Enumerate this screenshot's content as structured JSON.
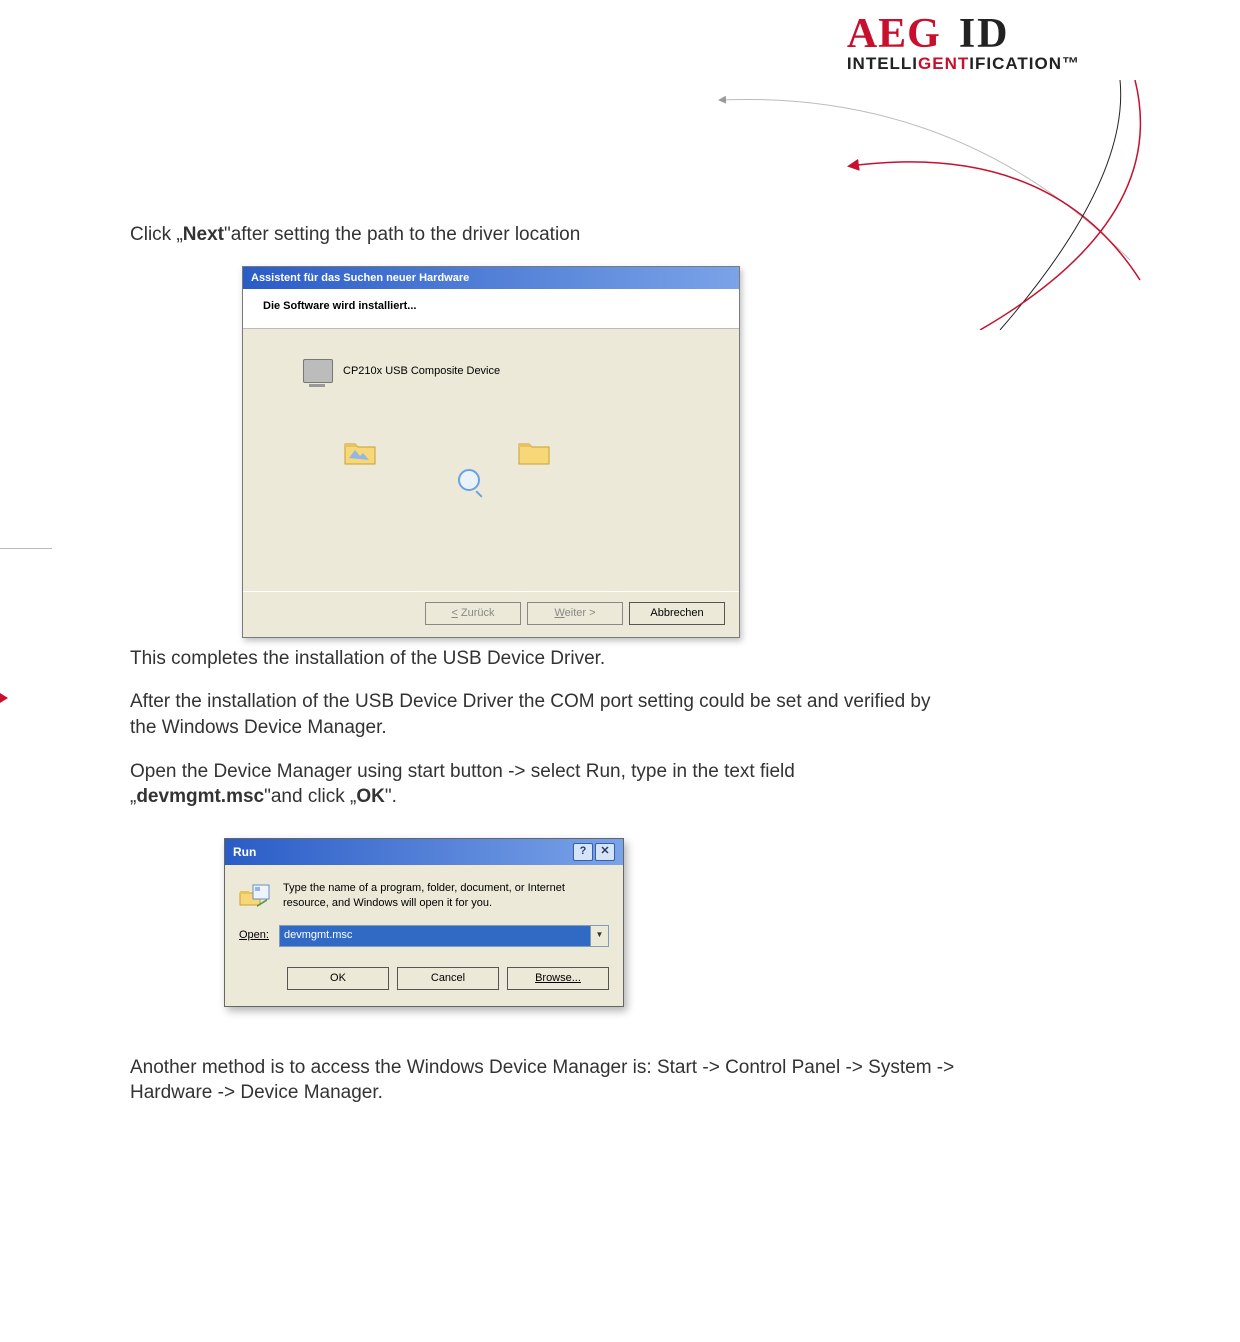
{
  "logo": {
    "aeg": "AEG",
    "id": "ID",
    "sub_pre": "INTELLI",
    "sub_mid": "GENT",
    "sub_post": "IFICATION",
    "tm": "™"
  },
  "text": {
    "intro_1a": "Click „",
    "intro_1b": "Next",
    "intro_1c": "\"after setting the path to the driver location",
    "after_wizard": "This completes the installation of the USB Device Driver.",
    "p2": "After the installation of the USB Device Driver the COM port setting could be set and verified by the Windows Device Manager.",
    "p3a": "Open the Device Manager using start button -> select Run, type in the text field „",
    "p3b": "devmgmt.msc",
    "p3c": "\"and click  „",
    "p3d": "OK",
    "p3e": "\".",
    "final": "Another method is to access the Windows Device Manager is: Start -> Control Panel -> System -> Hardware -> Device Manager."
  },
  "wizard": {
    "title": "Assistent für das Suchen neuer Hardware",
    "header": "Die Software wird installiert...",
    "device": "CP210x USB Composite Device",
    "buttons": {
      "back": "< Zurück",
      "next": "Weiter >",
      "cancel": "Abbrechen"
    }
  },
  "run": {
    "title": "Run",
    "help_btn": "?",
    "close_btn": "✕",
    "desc": "Type the name of a program, folder, document, or Internet resource, and Windows will open it for you.",
    "open_label": "Open:",
    "value": "devmgmt.msc",
    "buttons": {
      "ok": "OK",
      "cancel": "Cancel",
      "browse": "Browse..."
    }
  }
}
